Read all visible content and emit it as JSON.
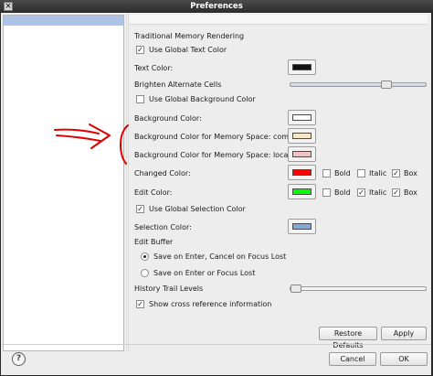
{
  "window": {
    "title": "Preferences",
    "close_glyph": "×"
  },
  "section_memory": {
    "label": "Traditional Memory Rendering"
  },
  "use_global_text": {
    "label": "Use Global Text Color",
    "checked": true
  },
  "text_color": {
    "label": "Text Color:",
    "swatch": "#111111"
  },
  "brighten": {
    "label": "Brighten Alternate Cells",
    "level": 0.72
  },
  "use_global_background": {
    "label": "Use Global Background Color",
    "checked": false
  },
  "background_color": {
    "label": "Background Color:",
    "swatch": "#ffffff"
  },
  "bg_common": {
    "label": "Background Color for Memory Space: common",
    "swatch": "#f9e6c4"
  },
  "bg_local": {
    "label": "Background Color for Memory Space: local",
    "swatch": "#f0c4c4"
  },
  "changed_color": {
    "label": "Changed Color:",
    "swatch": "#ff0000",
    "bold": {
      "label": "Bold",
      "checked": false
    },
    "italic": {
      "label": "Italic",
      "checked": false
    },
    "box": {
      "label": "Box",
      "checked": true
    }
  },
  "edit_color": {
    "label": "Edit Color:",
    "swatch": "#00ff00",
    "bold": {
      "label": "Bold",
      "checked": false
    },
    "italic": {
      "label": "Italic",
      "checked": true
    },
    "box": {
      "label": "Box",
      "checked": true
    }
  },
  "use_global_selection": {
    "label": "Use Global Selection Color",
    "checked": true
  },
  "selection_color": {
    "label": "Selection Color:",
    "swatch": "#7fa9d8"
  },
  "edit_buffer": {
    "label": "Edit Buffer",
    "options": [
      {
        "label": "Save on Enter, Cancel on Focus Lost",
        "selected": true
      },
      {
        "label": "Save on Enter or Focus Lost",
        "selected": false
      }
    ]
  },
  "history_trail": {
    "label": "History Trail Levels",
    "level": 0.0
  },
  "show_xref": {
    "label": "Show cross reference information",
    "checked": true
  },
  "buttons": {
    "restore_defaults": "Restore Defaults",
    "apply": "Apply",
    "cancel": "Cancel",
    "ok": "OK",
    "help": "?"
  },
  "check_glyph": "✓",
  "annotation_color": "#e00000"
}
